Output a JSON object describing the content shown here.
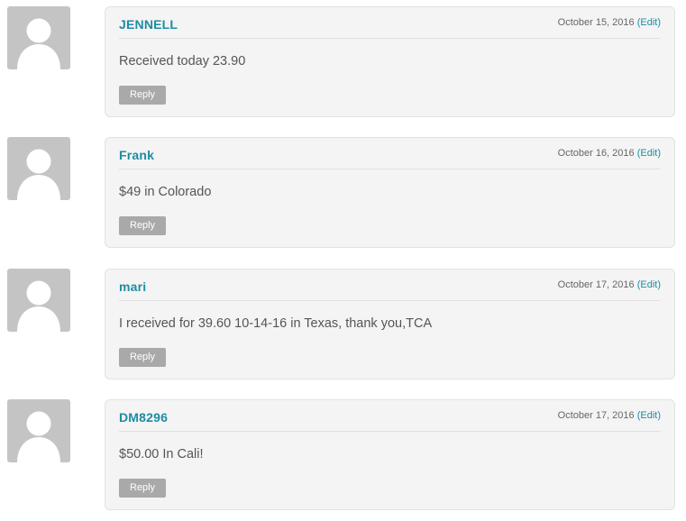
{
  "comments": [
    {
      "author": "JENNELL",
      "date": "October 15, 2016",
      "edit_label": "(Edit)",
      "text": "Received today 23.90",
      "reply_label": "Reply"
    },
    {
      "author": "Frank",
      "date": "October 16, 2016",
      "edit_label": "(Edit)",
      "text": "$49 in Colorado",
      "reply_label": "Reply"
    },
    {
      "author": "mari",
      "date": "October 17, 2016",
      "edit_label": "(Edit)",
      "text": "I received for 39.60 10-14-16 in Texas, thank you,TCA",
      "reply_label": "Reply"
    },
    {
      "author": "DM8296",
      "date": "October 17, 2016",
      "edit_label": "(Edit)",
      "text": "$50.00 In Cali!",
      "reply_label": "Reply"
    }
  ],
  "avatar_icon": "default-user-avatar-icon",
  "colors": {
    "author_link": "#1e8ca3",
    "reply_button": "#a9a9a9",
    "bubble_background": "#f4f4f4",
    "avatar_background": "#c4c4c4"
  }
}
